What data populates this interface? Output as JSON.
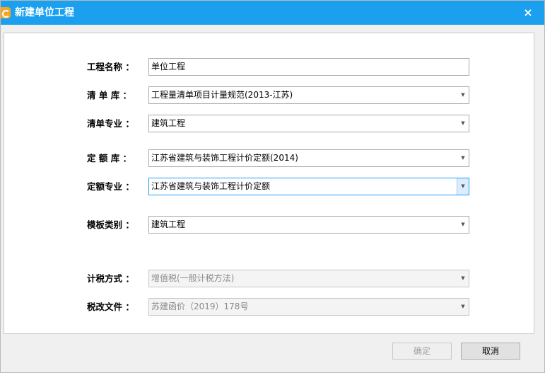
{
  "window": {
    "title": "新建单位工程",
    "close_glyph": "×"
  },
  "form": {
    "project_name": {
      "label": "工程名称 ：",
      "value": "单位工程"
    },
    "bill_library": {
      "label": "清 单 库 ：",
      "value": "工程量清单项目计量规范(2013-江苏)"
    },
    "bill_major": {
      "label": "清单专业 ：",
      "value": "建筑工程"
    },
    "quota_library": {
      "label": "定 额 库 ：",
      "value": "江苏省建筑与装饰工程计价定额(2014)"
    },
    "quota_major": {
      "label": "定额专业 ：",
      "value": "江苏省建筑与装饰工程计价定额"
    },
    "template_type": {
      "label": "模板类别 ：",
      "value": "建筑工程"
    },
    "tax_method": {
      "label": "计税方式 ：",
      "value": "增值税(一般计税方法)"
    },
    "tax_document": {
      "label": "税改文件 ：",
      "value": "苏建函价（2019）178号"
    }
  },
  "buttons": {
    "ok": "确定",
    "cancel": "取消"
  },
  "dropdown_glyph": "▼",
  "colors": {
    "titlebar": "#1aa0ef",
    "app_icon": "#f5a623"
  }
}
